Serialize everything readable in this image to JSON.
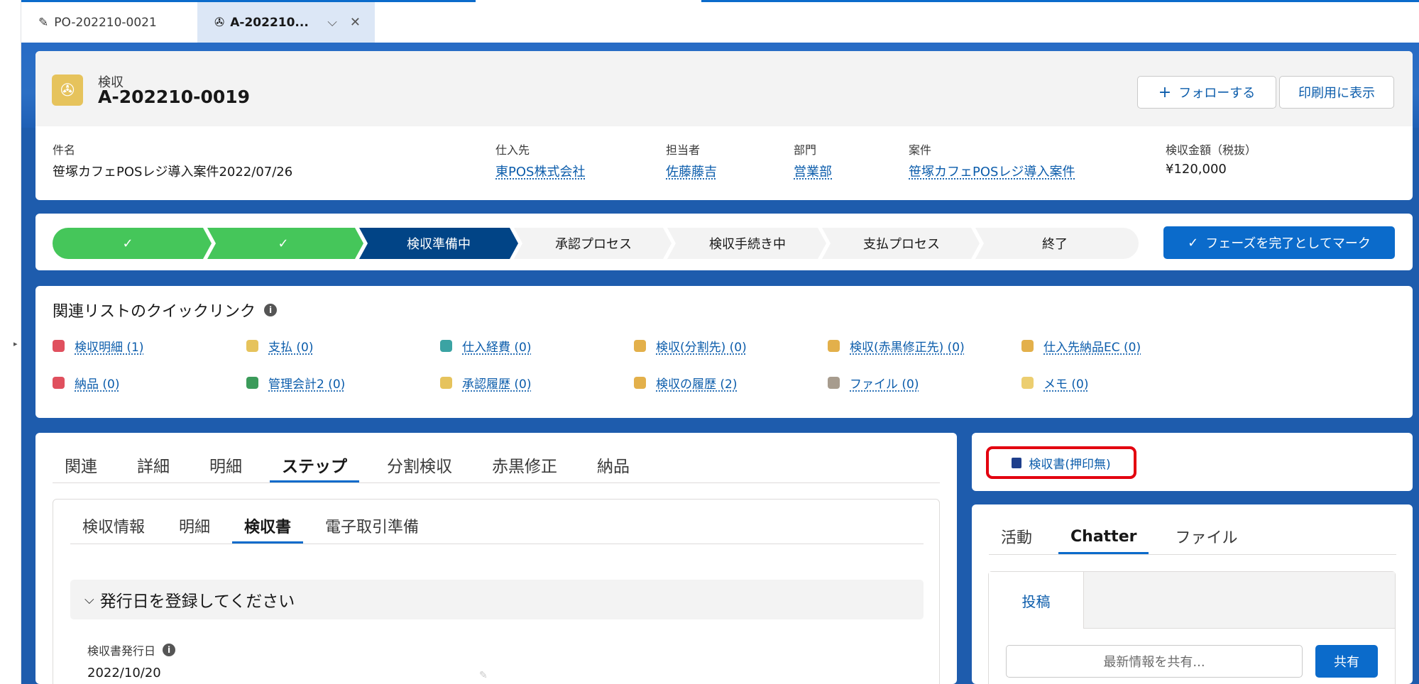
{
  "workspace_tabs": [
    {
      "label": "PO-202210-0021",
      "icon": "pencil-icon"
    },
    {
      "label": "A-202210...",
      "icon": "inspection-icon"
    }
  ],
  "record": {
    "object_type": "検収",
    "name": "A-202210-0019",
    "follow_label": "フォローする",
    "print_label": "印刷用に表示"
  },
  "highlights": [
    {
      "label": "件名",
      "value": "笹塚カフェPOSレジ導入案件2022/07/26",
      "link": false
    },
    {
      "label": "仕入先",
      "value": "東POS株式会社",
      "link": true
    },
    {
      "label": "担当者",
      "value": "佐藤藤吉",
      "link": true
    },
    {
      "label": "部門",
      "value": "営業部",
      "link": true
    },
    {
      "label": "案件",
      "value": "笹塚カフェPOSレジ導入案件",
      "link": true
    },
    {
      "label": "検収金額（税抜）",
      "value": "¥120,000",
      "link": false
    }
  ],
  "path": {
    "steps": [
      {
        "label": "✓",
        "state": "complete"
      },
      {
        "label": "✓",
        "state": "complete"
      },
      {
        "label": "検収準備中",
        "state": "current"
      },
      {
        "label": "承認プロセス",
        "state": "incomplete"
      },
      {
        "label": "検収手続き中",
        "state": "incomplete"
      },
      {
        "label": "支払プロセス",
        "state": "incomplete"
      },
      {
        "label": "終了",
        "state": "incomplete"
      }
    ],
    "mark_complete_label": "フェーズを完了としてマーク"
  },
  "quick_links": {
    "title": "関連リストのクイックリンク",
    "items": [
      {
        "label": "検収明細 (1)",
        "color": "#e0505e"
      },
      {
        "label": "支払 (0)",
        "color": "#e6c35c"
      },
      {
        "label": "仕入経費 (0)",
        "color": "#3ba3a3"
      },
      {
        "label": "検収(分割先) (0)",
        "color": "#e3b04b"
      },
      {
        "label": "検収(赤黒修正先) (0)",
        "color": "#e3b04b"
      },
      {
        "label": "仕入先納品EC (0)",
        "color": "#e3b04b"
      },
      {
        "label": "納品 (0)",
        "color": "#e0505e"
      },
      {
        "label": "管理会計2 (0)",
        "color": "#3b9b5a"
      },
      {
        "label": "承認履歴 (0)",
        "color": "#e6c35c"
      },
      {
        "label": "検収の履歴 (2)",
        "color": "#e3b04b"
      },
      {
        "label": "ファイル (0)",
        "color": "#a79c8e"
      },
      {
        "label": "メモ (0)",
        "color": "#ecce70"
      }
    ]
  },
  "main_tabs": [
    "関連",
    "詳細",
    "明細",
    "ステップ",
    "分割検収",
    "赤黒修正",
    "納品"
  ],
  "main_tabs_active": "ステップ",
  "sub_tabs": [
    "検収情報",
    "明細",
    "検収書",
    "電子取引準備"
  ],
  "sub_tabs_active": "検収書",
  "section": {
    "title": "発行日を登録してください",
    "field_label": "検収書発行日",
    "field_value": "2022/10/20"
  },
  "doc_button_label": "検収書(押印無)",
  "side_tabs": [
    "活動",
    "Chatter",
    "ファイル"
  ],
  "side_tabs_active": "Chatter",
  "composer": {
    "post_tab": "投稿",
    "placeholder": "最新情報を共有...",
    "share_label": "共有"
  }
}
